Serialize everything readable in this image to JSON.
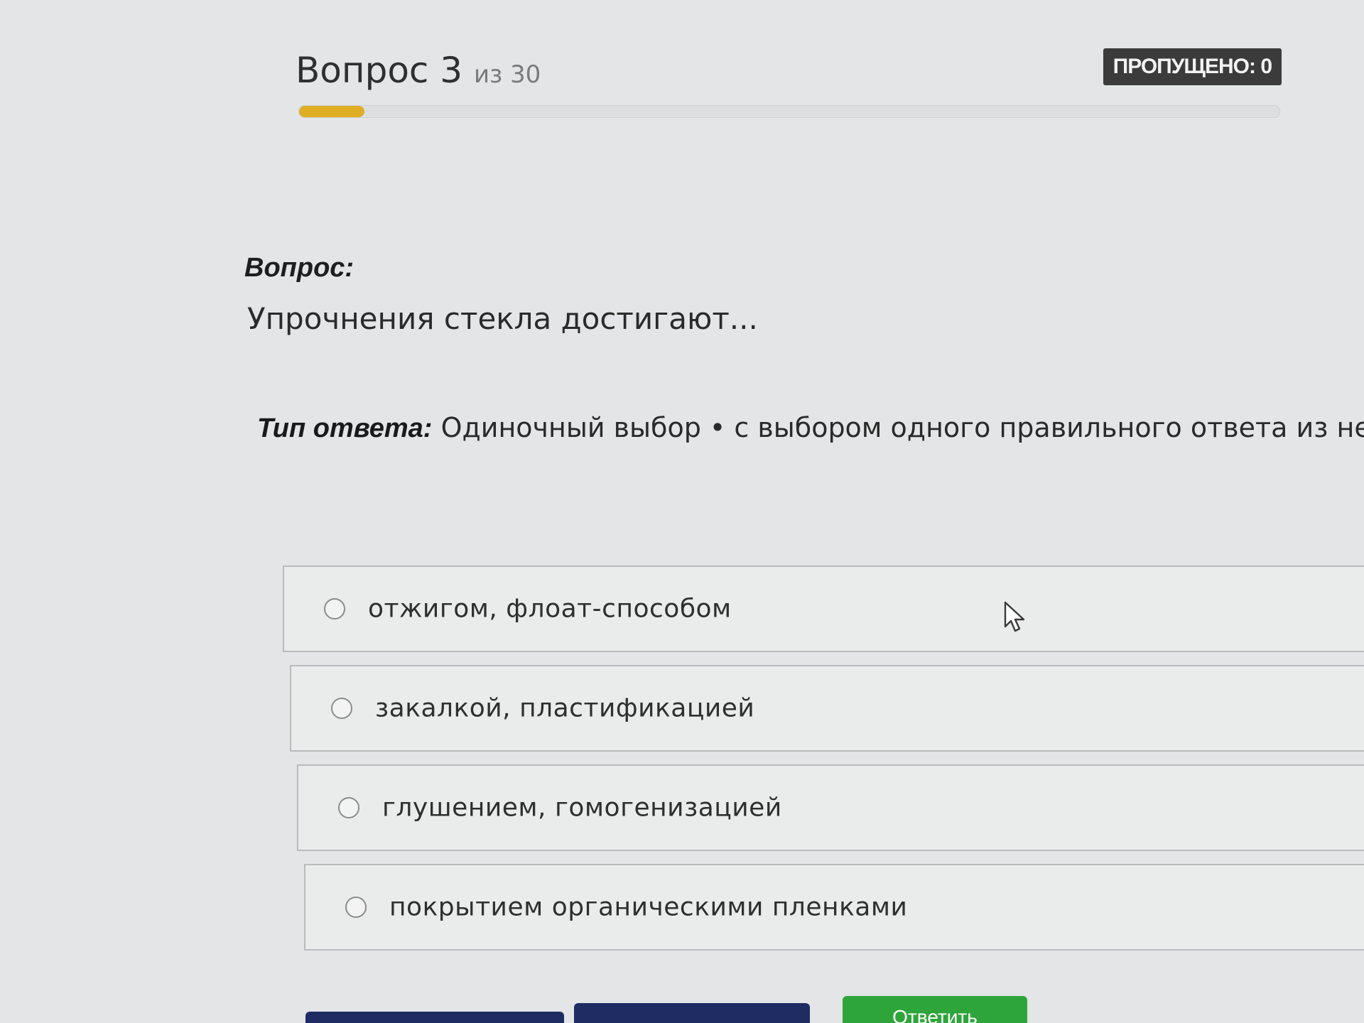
{
  "header": {
    "question_word": "Вопрос 3",
    "of_total": "из 30",
    "skipped_badge": "ПРОПУЩЕНО: 0",
    "progress_fraction": 0.067
  },
  "question": {
    "label": "Вопрос:",
    "text": "Упрочнения стекла достигают..."
  },
  "answer_type": {
    "label": "Тип ответа:",
    "value": "Одиночный выбор • с выбором одного правильного ответа из несколь"
  },
  "options": [
    {
      "text": "отжигом, флоат-способом",
      "selected": false
    },
    {
      "text": "закалкой, пластификацией",
      "selected": false
    },
    {
      "text": "глушением, гомогенизацией",
      "selected": false
    },
    {
      "text": "покрытием органическими пленками",
      "selected": false
    }
  ],
  "buttons": {
    "prev": "",
    "next": "",
    "answer": "Ответить"
  },
  "colors": {
    "progress": "#e0ae24",
    "nav_button": "#1e2c63",
    "answer_button": "#2ea53b",
    "badge": "#3b3b3b"
  }
}
